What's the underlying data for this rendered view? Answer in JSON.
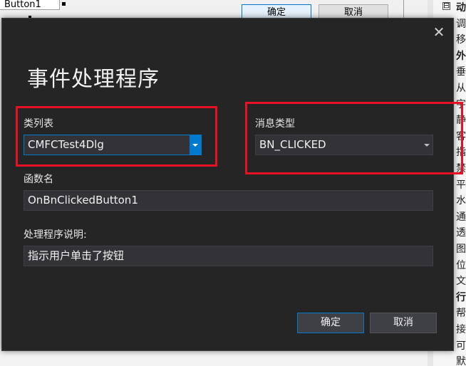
{
  "background": {
    "designer": {
      "button1_label": "Button1",
      "ok_label": "确定",
      "cancel_label": "取消"
    },
    "properties": {
      "category_toggle": "⊟",
      "rows": [
        {
          "text": "动",
          "bold": true
        },
        {
          "text": "调",
          "bold": false
        },
        {
          "text": "移",
          "bold": false
        },
        {
          "text": "外",
          "bold": true
        },
        {
          "text": "垂",
          "bold": false
        },
        {
          "text": "从",
          "bold": false
        },
        {
          "text": "字",
          "bold": false
        },
        {
          "text": "静",
          "bold": false
        },
        {
          "text": "客",
          "bold": false
        },
        {
          "text": "指",
          "bold": false
        },
        {
          "text": "禁",
          "bold": false
        },
        {
          "text": "平",
          "bold": false
        },
        {
          "text": "水",
          "bold": false
        },
        {
          "text": "通",
          "bold": false
        },
        {
          "text": "透",
          "bold": false
        },
        {
          "text": "图",
          "bold": false
        },
        {
          "text": "位",
          "bold": false
        },
        {
          "text": "文",
          "bold": false
        },
        {
          "text": "行",
          "bold": true
        },
        {
          "text": "帮",
          "bold": false
        },
        {
          "text": "接",
          "bold": false
        },
        {
          "text": "可",
          "bold": false
        },
        {
          "text": "默",
          "bold": false
        }
      ]
    }
  },
  "dialog": {
    "close_glyph": "✕",
    "title": "事件处理程序",
    "class_list": {
      "label": "类列表",
      "value": "CMFCTest4Dlg"
    },
    "message_type": {
      "label": "消息类型",
      "value": "BN_CLICKED"
    },
    "function_name": {
      "label": "函数名",
      "value": "OnBnClickedButton1"
    },
    "handler_description": {
      "label": "处理程序说明:",
      "value": "指示用户单击了按钮"
    },
    "buttons": {
      "ok": "确定",
      "cancel": "取消"
    },
    "colors": {
      "background": "#252526",
      "field": "#333337",
      "accent": "#007acc",
      "highlight": "#e81123"
    }
  }
}
